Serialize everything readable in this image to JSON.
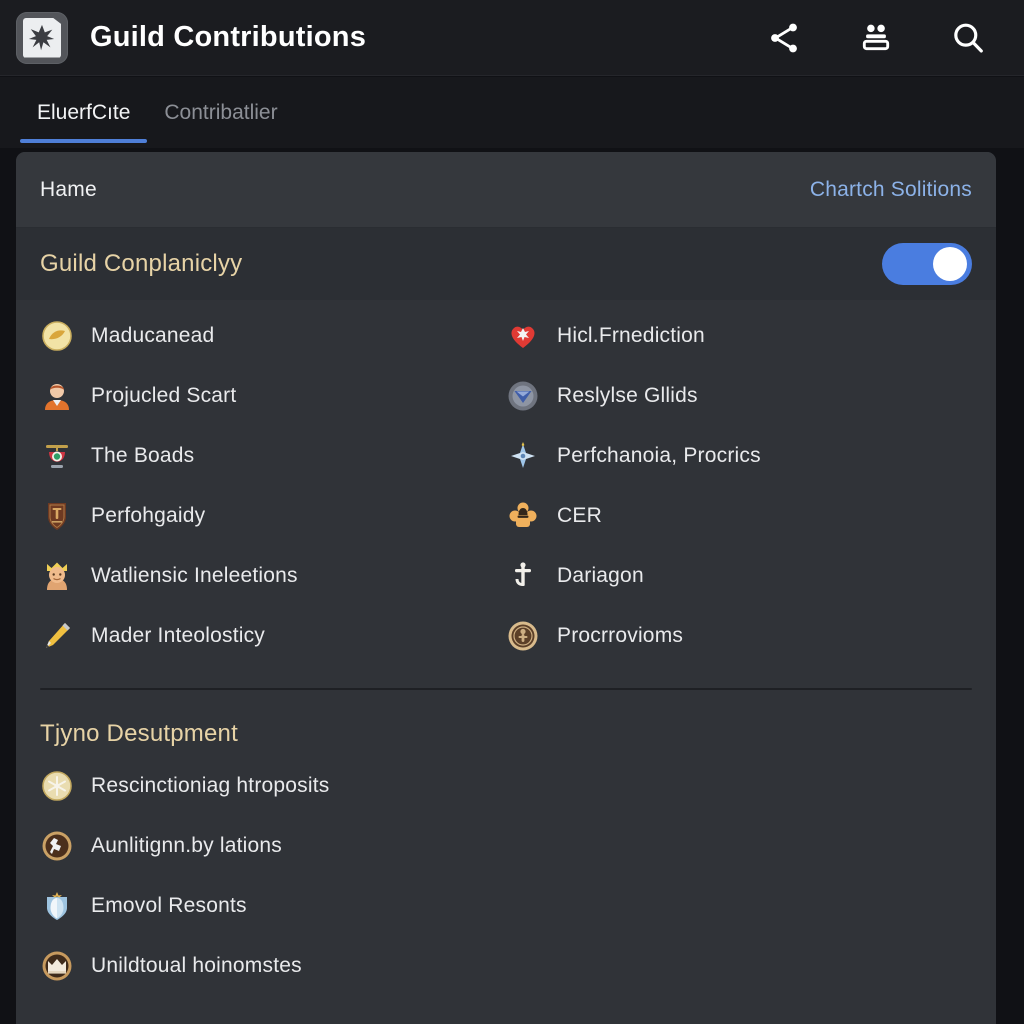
{
  "appbar": {
    "icon": "app-puzzle-icon",
    "title": "Guild Contributions",
    "actions": [
      {
        "name": "share-icon",
        "label": "Share"
      },
      {
        "name": "group-members-icon",
        "label": "Members"
      },
      {
        "name": "search-icon",
        "label": "Search"
      }
    ]
  },
  "tabs": [
    {
      "label": "EluerfCıte",
      "active": true
    },
    {
      "label": "Contribatlier",
      "active": false
    }
  ],
  "card": {
    "topbar": {
      "left_label": "Hame",
      "right_label": "Chartch Solitions"
    },
    "section_1": {
      "title": "Guild Conplaniclyy",
      "toggle_on": true,
      "entries": [
        {
          "icon": "golden-coin-icon",
          "label": "Maducanead"
        },
        {
          "icon": "red-heart-shield-icon",
          "label": "Hicl.Frnediction"
        },
        {
          "icon": "orange-person-icon",
          "label": "Projucled Scart"
        },
        {
          "icon": "blue-chevron-badge-icon",
          "label": "Reslylse Gllids"
        },
        {
          "icon": "red-lantern-icon",
          "label": "The Boads"
        },
        {
          "icon": "blue-compass-star-icon",
          "label": "Perfchanoia, Procrics"
        },
        {
          "icon": "brown-crest-shield-icon",
          "label": "Perfohgaidy"
        },
        {
          "icon": "orange-bell-figure-icon",
          "label": "CER"
        },
        {
          "icon": "crowned-head-icon",
          "label": "Watliensic Ineleetions"
        },
        {
          "icon": "white-anchor-icon",
          "label": "Dariagon"
        },
        {
          "icon": "yellow-pencil-icon",
          "label": "Mader Inteolosticy"
        },
        {
          "icon": "bronze-medallion-icon",
          "label": "Procrrovioms"
        }
      ]
    },
    "section_2": {
      "title": "Tjyno Desutpment",
      "entries": [
        {
          "icon": "gold-snowflake-icon",
          "label": "Rescinctioniag htroposits"
        },
        {
          "icon": "bronze-runner-icon",
          "label": "Aunlitignn.by lations"
        },
        {
          "icon": "silver-crest-icon",
          "label": "Emovol Resonts"
        },
        {
          "icon": "bronze-crown-icon",
          "label": "Unildtoual hoinomstes"
        }
      ]
    }
  },
  "colors": {
    "page_background": "#101115",
    "appbar_background": "#1b1c20",
    "card_background": "#303338",
    "card_topbar_background": "#35383d",
    "section_header_background": "#2c2f34",
    "accent_blue": "#4f7fd8",
    "toggle_blue": "#4a7de0",
    "link_blue": "#8cb2e8",
    "section_title_gold": "#e7d3a6",
    "text_primary": "#e9eaec",
    "text_muted": "#8c8f96"
  }
}
